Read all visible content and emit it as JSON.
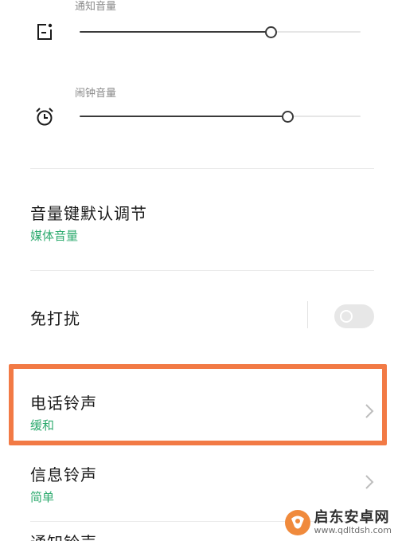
{
  "notification_volume": {
    "label": "通知音量",
    "icon": "notification-icon",
    "level_percent": 68
  },
  "alarm_volume": {
    "label": "闹钟音量",
    "icon": "alarm-clock-icon",
    "level_percent": 74
  },
  "volume_key_default": {
    "title": "音量键默认调节",
    "value": "媒体音量"
  },
  "do_not_disturb": {
    "title": "免打扰",
    "toggle_on": false
  },
  "phone_ringtone": {
    "title": "电话铃声",
    "value": "缓和"
  },
  "message_ringtone": {
    "title": "信息铃声",
    "value": "简单"
  },
  "notification_ringtone": {
    "title": "通知铃声"
  },
  "watermark": {
    "name": "启东安卓网",
    "url": "www.qdltdsh.com"
  },
  "colors": {
    "accent_green": "#2daa6e",
    "highlight_orange": "#f27a45",
    "slider_dark": "#3a3a3a"
  }
}
